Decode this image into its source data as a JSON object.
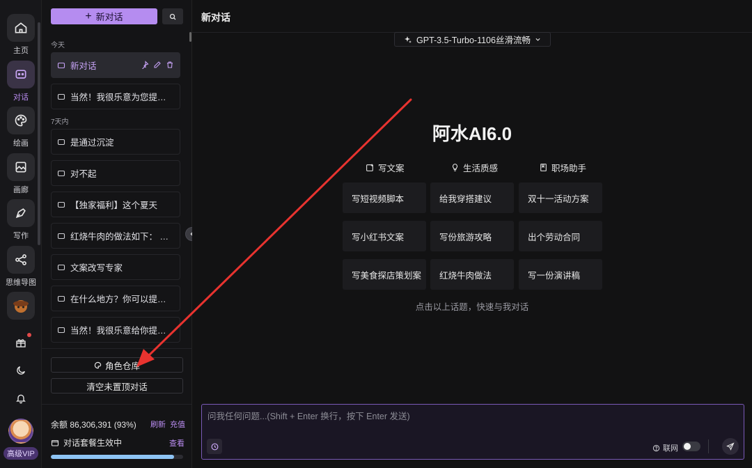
{
  "rail": {
    "items": [
      {
        "label": "主页",
        "icon": "home-icon"
      },
      {
        "label": "对话",
        "icon": "chat-bubble-icon",
        "active": true
      },
      {
        "label": "绘画",
        "icon": "palette-icon"
      },
      {
        "label": "画廊",
        "icon": "image-icon"
      },
      {
        "label": "写作",
        "icon": "pen-icon"
      },
      {
        "label": "思维导图",
        "icon": "mindmap-icon"
      }
    ],
    "vip_label": "高级VIP"
  },
  "sidebar": {
    "new_chat_label": "新对话",
    "group_today": "今天",
    "group_week": "7天内",
    "today_items": [
      "新对话",
      "当然！我很乐意为您提供帮助"
    ],
    "week_items": [
      "是通过沉淀",
      "对不起",
      "【独家福利】这个夏天",
      "红烧牛肉的做法如下：  材料",
      "文案改写专家",
      "在什么地方？你可以提供更多",
      "当然！我很乐意给你提供帮助"
    ],
    "role_library_label": "角色仓库",
    "clear_label": "清空未置顶对话",
    "balance_text": "余额 86,306,391 (93%)",
    "refresh_label": "刷新",
    "recharge_label": "充值",
    "plan_text": "对话套餐生效中",
    "plan_link": "查看",
    "progress": 0.93
  },
  "main": {
    "title": "新对话",
    "model": "GPT-3.5-Turbo-1106丝滑流畅",
    "brand": "阿水AI6.0",
    "categories": [
      "写文案",
      "生活质感",
      "职场助手"
    ],
    "cards": [
      [
        "写短视频脚本",
        "给我穿搭建议",
        "双十一活动方案"
      ],
      [
        "写小红书文案",
        "写份旅游攻略",
        "出个劳动合同"
      ],
      [
        "写美食探店策划案",
        "红烧牛肉做法",
        "写一份演讲稿"
      ]
    ],
    "hint": "点击以上话题，快速与我对话",
    "input_placeholder": "问我任何问题...(Shift + Enter 换行，按下 Enter 发送)",
    "net_label": "联网"
  },
  "colors": {
    "accent": "#b58cf0",
    "annotation_arrow": "#e8332f"
  }
}
